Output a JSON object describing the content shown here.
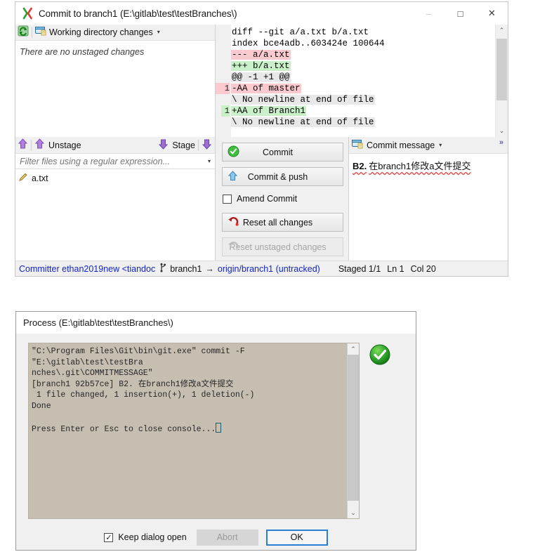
{
  "commit_window": {
    "title": "Commit to branch1 (E:\\gitlab\\test\\testBranches\\)",
    "title_icon": "gitextensions-x-icon",
    "window_controls": {
      "minimize": "–",
      "maximize": "□",
      "close": "✕"
    },
    "working_directory": {
      "refresh_icon": "refresh-icon",
      "panel_icon": "changes-icon",
      "header_label": "Working directory changes",
      "dropdown_caret": "▾",
      "empty_text": "There are no unstaged changes"
    },
    "diff": {
      "lines": [
        {
          "num": "",
          "kind": "ctx",
          "text": "diff --git a/a.txt b/a.txt"
        },
        {
          "num": "",
          "kind": "ctx",
          "text": "index bce4adb..603424e 100644"
        },
        {
          "num": "",
          "kind": "del",
          "text": "--- a/a.txt"
        },
        {
          "num": "",
          "kind": "add",
          "text": "+++ b/a.txt"
        },
        {
          "num": "",
          "kind": "gray",
          "text": "@@ -1 +1 @@"
        },
        {
          "num": "1",
          "kind": "del",
          "text": "-AA of master"
        },
        {
          "num": "",
          "kind": "gray",
          "text": "\\ No newline at end of file"
        },
        {
          "num": "1",
          "kind": "add",
          "text": "+AA of Branch1"
        },
        {
          "num": "",
          "kind": "gray",
          "text": "\\ No newline at end of file"
        }
      ],
      "scroll_up": "⌃",
      "scroll_down": "⌄"
    },
    "stage_toolbar": {
      "unstage_icon": "arrow-up-purple-icon",
      "unstage_label": "Unstage",
      "stage_label": "Stage",
      "stage_icon": "arrow-down-purple-icon"
    },
    "filter": {
      "placeholder": "Filter files using a regular expression...",
      "value": "",
      "caret": "▾"
    },
    "files": [
      {
        "icon": "pencil-modified-icon",
        "name": "a.txt"
      }
    ],
    "buttons": {
      "commit": {
        "label": "Commit",
        "icon": "green-check-icon"
      },
      "commit_push": {
        "label": "Commit & push",
        "icon": "blue-up-arrow-icon"
      },
      "amend": {
        "label": "Amend Commit",
        "checked": false,
        "check_glyph": ""
      },
      "reset_all": {
        "label": "Reset all changes",
        "icon": "red-undo-icon"
      },
      "reset_unstaged": {
        "label": "Reset unstaged changes",
        "icon": "gray-undo-icon",
        "disabled": true
      }
    },
    "commit_message": {
      "icon": "changes-icon",
      "header_label": "Commit message",
      "dropdown_caret": "▾",
      "expand_chevrons": "»",
      "prefix": "B2.",
      "text": "在branch1修改a文件提交"
    },
    "status_bar": {
      "committer": "Committer ethan2019new <tiandoc",
      "branch_icon": "branch-icon",
      "branch": "branch1",
      "arrow": "→",
      "remote": "origin/branch1 (untracked)",
      "staged": "Staged  1/1",
      "ln": "Ln 1",
      "col": "Col 20"
    }
  },
  "process_window": {
    "title": "Process (E:\\gitlab\\test\\testBranches\\)",
    "console_lines": [
      "\"C:\\Program Files\\Git\\bin\\git.exe\" commit -F \"E:\\gitlab\\test\\testBra",
      "nches\\.git\\COMMITMESSAGE\"",
      "[branch1 92b57ce] B2. 在branch1修改a文件提交",
      " 1 file changed, 1 insertion(+), 1 deletion(-)",
      "Done",
      "",
      "Press Enter or Esc to close console..."
    ],
    "status_icon": "green-success-icon",
    "scroll_up": "⌃",
    "scroll_down": "⌄",
    "footer": {
      "keep_dialog_open": {
        "label": "Keep dialog open",
        "checked": true,
        "check_glyph": "✓"
      },
      "abort": {
        "label": "Abort",
        "disabled": true
      },
      "ok": {
        "label": "OK"
      }
    }
  },
  "colors": {
    "accent_blue": "#1424c8",
    "diff_add": "#c9f0c9",
    "diff_del": "#fbc9ce",
    "console_bg": "#c6bfb1",
    "ok_border": "#2a7fd4"
  }
}
